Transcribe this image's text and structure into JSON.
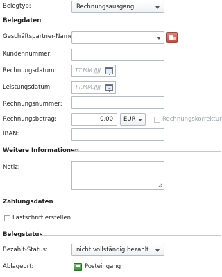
{
  "belegtyp": {
    "label": "Belegtyp:",
    "value": "Rechnungsausgang"
  },
  "belegdaten": {
    "title": "Belegdaten",
    "geschaeftspartner_label": "Geschäftspartner-Name:",
    "kundennummer_label": "Kundennummer:",
    "rechnungsdatum_label": "Rechnungsdatum:",
    "rechnungsdatum_placeholder": "TT.MM.JJJJ",
    "leistungsdatum_label": "Leistungsdatum:",
    "leistungsdatum_placeholder": "TT.MM.JJJJ",
    "rechnungsnummer_label": "Rechnungsnummer:",
    "rechnungsbetrag_label": "Rechnungsbetrag:",
    "rechnungsbetrag_value": "0,00",
    "currency": "EUR",
    "korrektur_label": "Rechnungskorrektur",
    "iban_label": "IBAN:"
  },
  "weitere": {
    "title": "Weitere Informationen",
    "notiz_label": "Notiz:"
  },
  "zahlungsdaten": {
    "title": "Zahlungsdaten",
    "lastschrift_label": "Lastschrift erstellen"
  },
  "belegstatus": {
    "title": "Belegstatus",
    "bezahlt_label": "Bezahlt-Status:",
    "bezahlt_value": "nicht vollständig bezahlt",
    "ablageort_label": "Ablageort:",
    "ablageort_value": "Posteingang"
  },
  "icons": {
    "dropdown": "chevron-down-icon",
    "calendar": "calendar-icon",
    "partner": "business-partner-icon",
    "inbox": "inbox-icon"
  }
}
